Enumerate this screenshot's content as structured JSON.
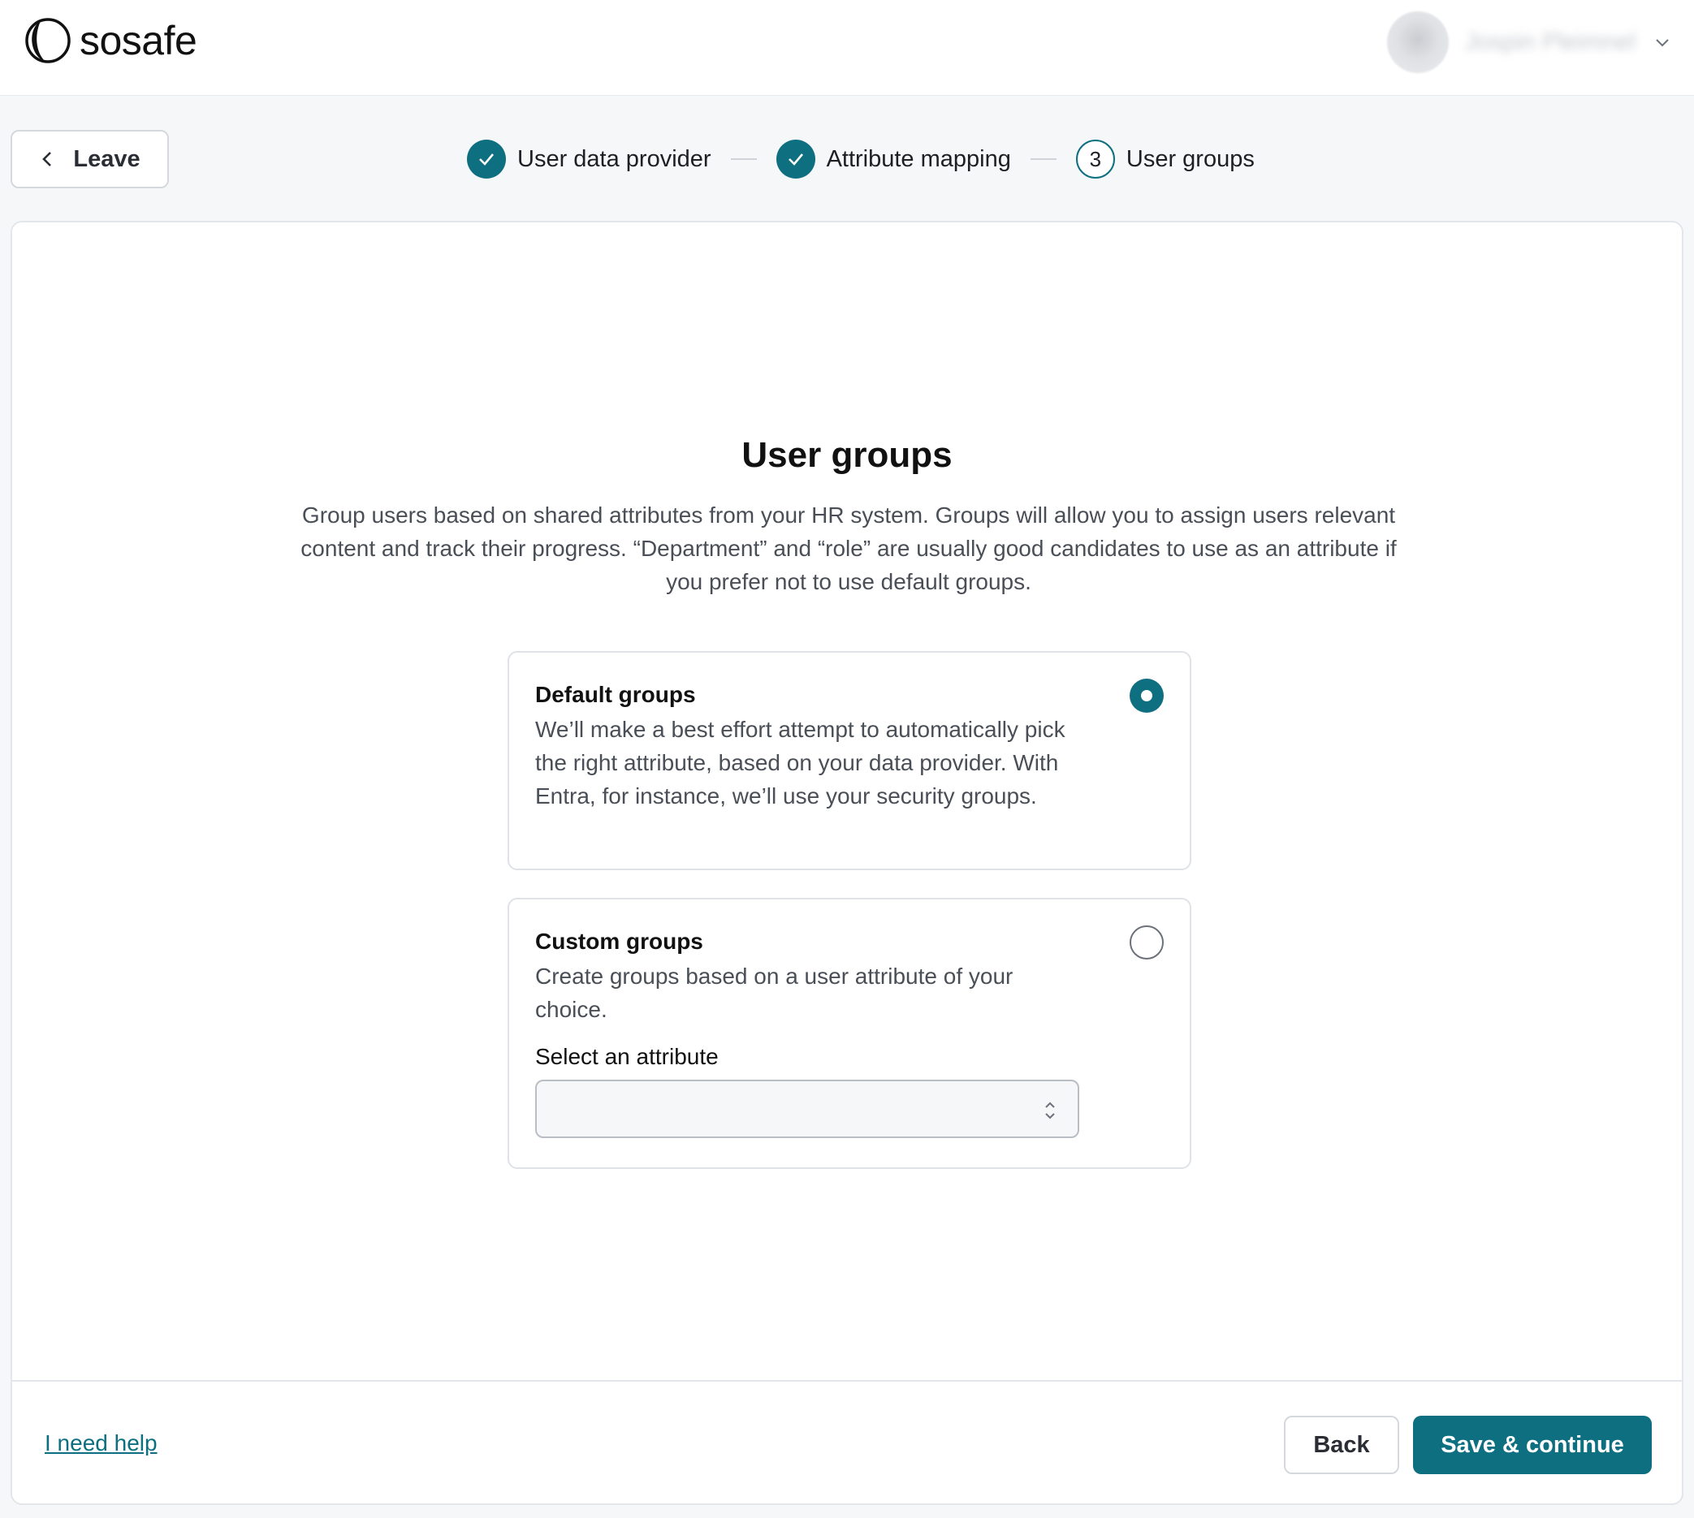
{
  "brand": {
    "name": "sosafe",
    "accent": "#0e6f80"
  },
  "header": {
    "user_name": "Jospin Pleimnel",
    "menu_icon": "chevron-down-icon"
  },
  "nav": {
    "leave_label": "Leave"
  },
  "stepper": {
    "steps": [
      {
        "label": "User data provider",
        "state": "done"
      },
      {
        "label": "Attribute mapping",
        "state": "done"
      },
      {
        "label": "User groups",
        "state": "current",
        "number": "3"
      }
    ]
  },
  "main": {
    "title": "User groups",
    "description": "Group users based on shared attributes from your HR system. Groups will allow you to assign users relevant content and track their progress. “Department” and “role” are usually good candidates to use as an attribute if you prefer not to use default groups.",
    "options": [
      {
        "title": "Default groups",
        "text": "We’ll make a best effort attempt to automatically pick the right attribute, based on your data provider. With Entra, for instance, we’ll use your security groups.",
        "selected": true
      },
      {
        "title": "Custom groups",
        "text": "Create groups based on a user attribute of your choice.",
        "selected": false,
        "select_label": "Select an attribute",
        "select_value": ""
      }
    ]
  },
  "footer": {
    "help_label": "I need help",
    "back_label": "Back",
    "save_label": "Save & continue"
  }
}
